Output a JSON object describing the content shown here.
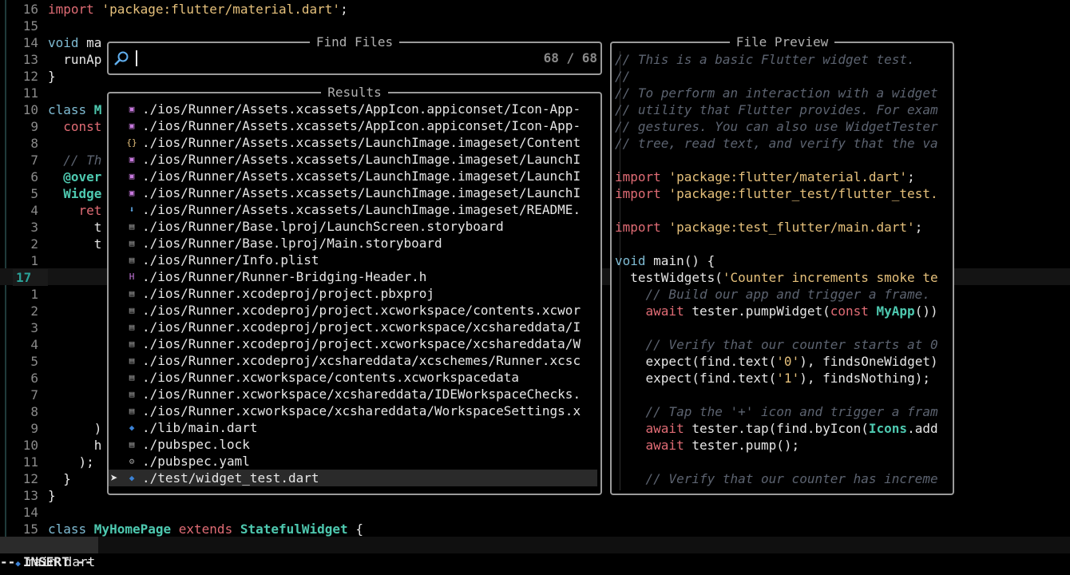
{
  "editor": {
    "lines": [
      {
        "num": "16",
        "code": [
          [
            "kw-import",
            "import "
          ],
          [
            "str",
            "'package:flutter/material.dart'"
          ],
          [
            "",
            "; "
          ]
        ]
      },
      {
        "num": "15",
        "code": []
      },
      {
        "num": "14",
        "code": [
          [
            "kw",
            "void "
          ],
          [
            "",
            "ma"
          ]
        ]
      },
      {
        "num": "13",
        "code": [
          [
            "",
            "  runAp"
          ]
        ]
      },
      {
        "num": "12",
        "code": [
          [
            "",
            "}"
          ]
        ]
      },
      {
        "num": "11",
        "code": []
      },
      {
        "num": "10",
        "code": [
          [
            "kw",
            "class "
          ],
          [
            "cls",
            "M"
          ]
        ]
      },
      {
        "num": "9",
        "code": [
          [
            "red",
            "  const"
          ]
        ]
      },
      {
        "num": "8",
        "code": []
      },
      {
        "num": "7",
        "code": [
          [
            "cmt",
            "  // Th"
          ]
        ]
      },
      {
        "num": "6",
        "code": [
          [
            "cls",
            "  @over"
          ]
        ]
      },
      {
        "num": "5",
        "code": [
          [
            "cls",
            "  Widge"
          ]
        ]
      },
      {
        "num": "4",
        "code": [
          [
            "red",
            "    ret"
          ]
        ]
      },
      {
        "num": "3",
        "code": [
          [
            "",
            "      t"
          ]
        ]
      },
      {
        "num": "2",
        "code": [
          [
            "",
            "      t"
          ]
        ]
      },
      {
        "num": "1",
        "code": []
      },
      {
        "num": "17",
        "code": [],
        "current": true
      },
      {
        "num": "1",
        "code": []
      },
      {
        "num": "2",
        "code": []
      },
      {
        "num": "3",
        "code": []
      },
      {
        "num": "4",
        "code": []
      },
      {
        "num": "5",
        "code": []
      },
      {
        "num": "6",
        "code": []
      },
      {
        "num": "7",
        "code": []
      },
      {
        "num": "8",
        "code": []
      },
      {
        "num": "9",
        "code": [
          [
            "",
            "      )"
          ]
        ]
      },
      {
        "num": "10",
        "code": [
          [
            "",
            "      h"
          ]
        ]
      },
      {
        "num": "11",
        "code": [
          [
            "",
            "    );"
          ]
        ]
      },
      {
        "num": "12",
        "code": [
          [
            "",
            "  }"
          ]
        ]
      },
      {
        "num": "13",
        "code": [
          [
            "",
            "}"
          ]
        ]
      },
      {
        "num": "14",
        "code": []
      },
      {
        "num": "15",
        "code": [
          [
            "kw",
            "class "
          ],
          [
            "cls",
            "MyHomePage "
          ],
          [
            "red",
            "extends "
          ],
          [
            "cls",
            "StatefulWidget "
          ],
          [
            "",
            "{"
          ]
        ]
      }
    ]
  },
  "find_files": {
    "title": "Find Files",
    "query": "",
    "count": "68 / 68"
  },
  "results": {
    "title": "Results",
    "items": [
      {
        "icon": "image-icon",
        "glyph": "▣",
        "color": "#c678dd",
        "path": "./ios/Runner/Assets.xcassets/AppIcon.appiconset/Icon-App-"
      },
      {
        "icon": "image-icon",
        "glyph": "▣",
        "color": "#c678dd",
        "path": "./ios/Runner/Assets.xcassets/AppIcon.appiconset/Icon-App-"
      },
      {
        "icon": "json-icon",
        "glyph": "{}",
        "color": "#e5c07b",
        "path": "./ios/Runner/Assets.xcassets/LaunchImage.imageset/Content"
      },
      {
        "icon": "image-icon",
        "glyph": "▣",
        "color": "#c678dd",
        "path": "./ios/Runner/Assets.xcassets/LaunchImage.imageset/LaunchI"
      },
      {
        "icon": "image-icon",
        "glyph": "▣",
        "color": "#c678dd",
        "path": "./ios/Runner/Assets.xcassets/LaunchImage.imageset/LaunchI"
      },
      {
        "icon": "image-icon",
        "glyph": "▣",
        "color": "#c678dd",
        "path": "./ios/Runner/Assets.xcassets/LaunchImage.imageset/LaunchI"
      },
      {
        "icon": "markdown-icon",
        "glyph": "⬇",
        "color": "#61afef",
        "path": "./ios/Runner/Assets.xcassets/LaunchImage.imageset/README."
      },
      {
        "icon": "file-icon",
        "glyph": "▤",
        "color": "#9a9a9a",
        "path": "./ios/Runner/Base.lproj/LaunchScreen.storyboard"
      },
      {
        "icon": "file-icon",
        "glyph": "▤",
        "color": "#9a9a9a",
        "path": "./ios/Runner/Base.lproj/Main.storyboard"
      },
      {
        "icon": "file-icon",
        "glyph": "▤",
        "color": "#9a9a9a",
        "path": "./ios/Runner/Info.plist"
      },
      {
        "icon": "header-icon",
        "glyph": "H",
        "color": "#c678dd",
        "path": "./ios/Runner/Runner-Bridging-Header.h"
      },
      {
        "icon": "file-icon",
        "glyph": "▤",
        "color": "#9a9a9a",
        "path": "./ios/Runner.xcodeproj/project.pbxproj"
      },
      {
        "icon": "file-icon",
        "glyph": "▤",
        "color": "#9a9a9a",
        "path": "./ios/Runner.xcodeproj/project.xcworkspace/contents.xcwor"
      },
      {
        "icon": "file-icon",
        "glyph": "▤",
        "color": "#9a9a9a",
        "path": "./ios/Runner.xcodeproj/project.xcworkspace/xcshareddata/I"
      },
      {
        "icon": "file-icon",
        "glyph": "▤",
        "color": "#9a9a9a",
        "path": "./ios/Runner.xcodeproj/project.xcworkspace/xcshareddata/W"
      },
      {
        "icon": "file-icon",
        "glyph": "▤",
        "color": "#9a9a9a",
        "path": "./ios/Runner.xcodeproj/xcshareddata/xcschemes/Runner.xcsc"
      },
      {
        "icon": "file-icon",
        "glyph": "▤",
        "color": "#9a9a9a",
        "path": "./ios/Runner.xcworkspace/contents.xcworkspacedata"
      },
      {
        "icon": "file-icon",
        "glyph": "▤",
        "color": "#9a9a9a",
        "path": "./ios/Runner.xcworkspace/xcshareddata/IDEWorkspaceChecks."
      },
      {
        "icon": "file-icon",
        "glyph": "▤",
        "color": "#9a9a9a",
        "path": "./ios/Runner.xcworkspace/xcshareddata/WorkspaceSettings.x"
      },
      {
        "icon": "dart-icon",
        "glyph": "◆",
        "color": "#3b82d6",
        "path": "./lib/main.dart"
      },
      {
        "icon": "file-icon",
        "glyph": "▤",
        "color": "#9a9a9a",
        "path": "./pubspec.lock"
      },
      {
        "icon": "gear-icon",
        "glyph": "⚙",
        "color": "#9a9a9a",
        "path": "./pubspec.yaml"
      },
      {
        "icon": "dart-icon",
        "glyph": "◆",
        "color": "#3b82d6",
        "path": "./test/widget_test.dart",
        "selected": true
      }
    ]
  },
  "preview": {
    "title": "File Preview",
    "lines": [
      [
        [
          "cmt",
          "// This is a basic Flutter widget test."
        ]
      ],
      [
        [
          "cmt",
          "//"
        ]
      ],
      [
        [
          "cmt",
          "// To perform an interaction with a widget"
        ]
      ],
      [
        [
          "cmt",
          "// utility that Flutter provides. For exam"
        ]
      ],
      [
        [
          "cmt",
          "// gestures. You can also use WidgetTester"
        ]
      ],
      [
        [
          "cmt",
          "// tree, read text, and verify that the va"
        ]
      ],
      [],
      [
        [
          "kw-import",
          "import "
        ],
        [
          "str",
          "'package:flutter/material.dart'"
        ],
        [
          "",
          ";"
        ]
      ],
      [
        [
          "kw-import",
          "import "
        ],
        [
          "str",
          "'package:flutter_test/flutter_test."
        ]
      ],
      [],
      [
        [
          "kw-import",
          "import "
        ],
        [
          "str",
          "'package:test_flutter/main.dart'"
        ],
        [
          "",
          ";"
        ]
      ],
      [],
      [
        [
          "kw",
          "void "
        ],
        [
          "",
          "main() {"
        ]
      ],
      [
        [
          "",
          "  testWidgets("
        ],
        [
          "str",
          "'Counter increments smoke te"
        ]
      ],
      [
        [
          "cmt",
          "    // Build our app and trigger a frame."
        ]
      ],
      [
        [
          "red",
          "    await "
        ],
        [
          "",
          "tester.pumpWidget("
        ],
        [
          "red",
          "const "
        ],
        [
          "cls",
          "MyApp"
        ],
        [
          "",
          "())"
        ]
      ],
      [],
      [
        [
          "cmt",
          "    // Verify that our counter starts at 0"
        ]
      ],
      [
        [
          "",
          "    expect(find.text("
        ],
        [
          "str",
          "'0'"
        ],
        [
          "",
          "), findsOneWidget)"
        ]
      ],
      [
        [
          "",
          "    expect(find.text("
        ],
        [
          "str",
          "'1'"
        ],
        [
          "",
          "), findsNothing);"
        ]
      ],
      [],
      [
        [
          "cmt",
          "    // Tap the '+' icon and trigger a fram"
        ]
      ],
      [
        [
          "red",
          "    await "
        ],
        [
          "",
          "tester.tap(find.byIcon("
        ],
        [
          "cls",
          "Icons"
        ],
        [
          "",
          ".add"
        ]
      ],
      [
        [
          "red",
          "    await "
        ],
        [
          "",
          "tester.pump();"
        ]
      ],
      [],
      [
        [
          "cmt",
          "    // Verify that our counter has increme"
        ]
      ]
    ]
  },
  "statusline": {
    "filename": "main.dart",
    "mode": "-- INSERT --"
  }
}
